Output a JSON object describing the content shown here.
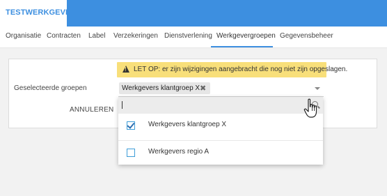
{
  "app": {
    "title": "TESTWERKGEVER",
    "accent_color": "#3d8fe0"
  },
  "tabs": [
    {
      "label": "Organisatie",
      "active": false
    },
    {
      "label": "Contracten",
      "active": false
    },
    {
      "label": "Label",
      "active": false
    },
    {
      "label": "Verzekeringen",
      "active": false
    },
    {
      "label": "Dienstverlening",
      "active": false
    },
    {
      "label": "Werkgevergroepen",
      "active": true
    },
    {
      "label": "Gegevensbeheer",
      "active": false
    }
  ],
  "warning": {
    "icon": "warning-icon",
    "text": "LET OP: er zijn wijzigingen aangebracht die nog niet zijn opgeslagen.",
    "color": "#f8df7a"
  },
  "form": {
    "label": "Geselecteerde groepen",
    "selected_chip": "Werkgevers klantgroep X",
    "cancel_label": "ANNULEREN"
  },
  "dropdown": {
    "search_value": "",
    "options": [
      {
        "label": "Werkgevers klantgroep X",
        "checked": true
      },
      {
        "label": "Werkgevers regio A",
        "checked": false
      }
    ]
  }
}
